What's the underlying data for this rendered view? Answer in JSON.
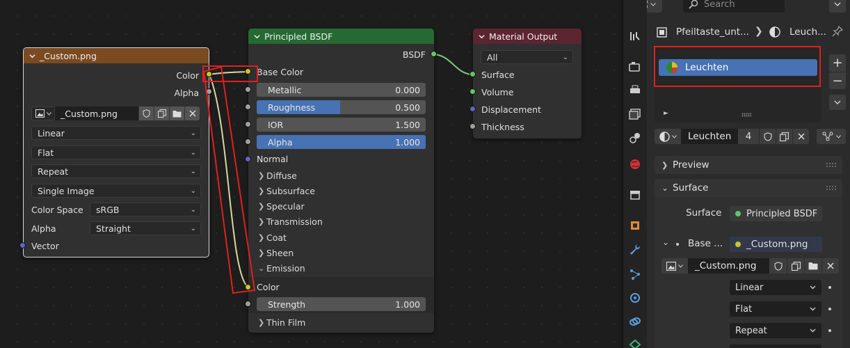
{
  "image_node": {
    "title": "_Custom.png",
    "outputs": [
      "Color",
      "Alpha"
    ],
    "image_name": "_Custom.png",
    "interpolation": "Linear",
    "projection": "Flat",
    "extension": "Repeat",
    "source": "Single Image",
    "color_space_label": "Color Space",
    "color_space_value": "sRGB",
    "alpha_label": "Alpha",
    "alpha_value": "Straight",
    "vector_label": "Vector"
  },
  "bsdf_node": {
    "title": "Principled BSDF",
    "output": "BSDF",
    "base_color": "Base Color",
    "metallic": {
      "label": "Metallic",
      "value": "0.000",
      "fraction": 0.0
    },
    "roughness": {
      "label": "Roughness",
      "value": "0.500",
      "fraction": 0.5
    },
    "ior": {
      "label": "IOR",
      "value": "1.500",
      "fraction": 0.0
    },
    "alpha": {
      "label": "Alpha",
      "value": "1.000",
      "fraction": 1.0
    },
    "normal": "Normal",
    "panels": [
      "Diffuse",
      "Subsurface",
      "Specular",
      "Transmission",
      "Coat",
      "Sheen",
      "Emission"
    ],
    "emission_color": "Color",
    "strength": {
      "label": "Strength",
      "value": "1.000"
    },
    "thin_film": "Thin Film"
  },
  "output_node": {
    "title": "Material Output",
    "target": "All",
    "inputs": [
      "Surface",
      "Volume",
      "Displacement",
      "Thickness"
    ]
  },
  "properties": {
    "search_placeholder": "Search",
    "breadcrumb_object": "Pfeiltaste_unt...",
    "breadcrumb_material": "Leuch...",
    "slot_name": "Leuchten",
    "material_name": "Leuchten",
    "user_count": "4",
    "preview_label": "Preview",
    "surface_panel_label": "Surface",
    "surface_label": "Surface",
    "surface_value": "Principled BSDF",
    "base_label": "Base ...",
    "base_value": "_Custom.png",
    "image_name": "_Custom.png",
    "interpolation": "Linear",
    "projection": "Flat",
    "extension": "Repeat"
  },
  "colors": {
    "image_header": "#7a4a21",
    "shader_header": "#256a32",
    "output_header": "#5c2531",
    "accent": "#4772b3",
    "highlight_red": "#e02020"
  }
}
